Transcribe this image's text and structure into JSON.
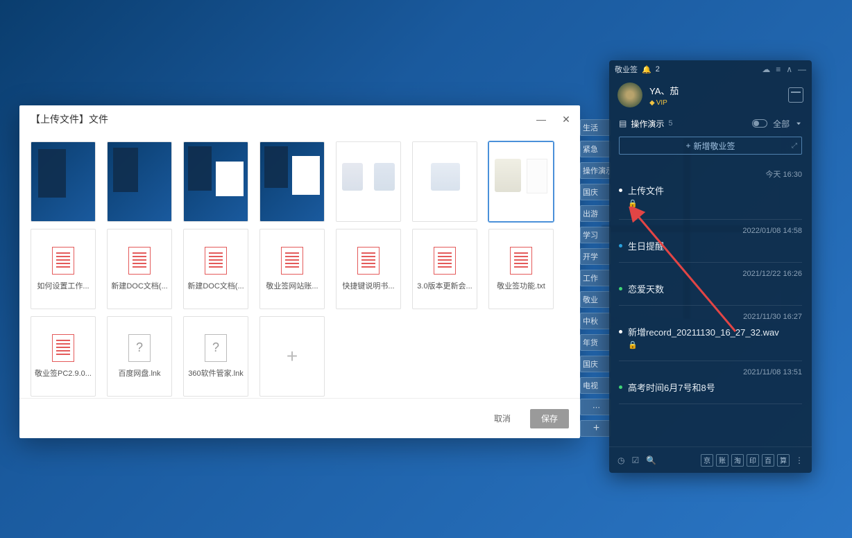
{
  "upload_dialog": {
    "title": "【上传文件】文件",
    "cancel": "取消",
    "save": "保存",
    "thumbs": [
      1,
      2,
      3,
      4,
      5,
      6,
      7
    ],
    "docs": [
      {
        "label": "如何设置工作...",
        "kind": "doc"
      },
      {
        "label": "新建DOC文档(...",
        "kind": "doc"
      },
      {
        "label": "新建DOC文档(...",
        "kind": "doc"
      },
      {
        "label": "敬业签网站账...",
        "kind": "doc"
      },
      {
        "label": "快捷键说明书...",
        "kind": "doc"
      },
      {
        "label": "3.0版本更新会...",
        "kind": "doc"
      },
      {
        "label": "敬业签功能.txt",
        "kind": "doc"
      },
      {
        "label": "敬业签PC2.9.0...",
        "kind": "doc"
      },
      {
        "label": "百度网盘.lnk",
        "kind": "unknown"
      },
      {
        "label": "360软件管家.lnk",
        "kind": "unknown"
      }
    ],
    "add": "+"
  },
  "side_tags": [
    "生活",
    "紧急",
    "操作演示",
    "国庆",
    "出游",
    "学习",
    "开学",
    "工作",
    "敬业",
    "中秋",
    "年货",
    "国庆",
    "电视"
  ],
  "side_more": "⋯",
  "side_plus": "+",
  "sticky": {
    "app_name": "敬业签",
    "notif_count": "2",
    "user_name": "YA、茄",
    "vip_label": "VIP",
    "section_title": "操作演示",
    "section_count": "5",
    "filter_label": "全部",
    "add_label": "新增敬业签",
    "items": [
      {
        "time": "今天 16:30",
        "text": "上传文件",
        "lock": true,
        "dot": "white"
      },
      {
        "time": "2022/01/08 14:58",
        "text": "生日提醒",
        "lock": false,
        "dot": "blue"
      },
      {
        "time": "2021/12/22 16:26",
        "text": "恋爱天数",
        "lock": false,
        "dot": "green"
      },
      {
        "time": "2021/11/30 16:27",
        "text": "新增record_20211130_16_27_32.wav",
        "lock": true,
        "dot": "white"
      },
      {
        "time": "2021/11/08 13:51",
        "text": "高考时间6月7号和8号",
        "lock": false,
        "dot": "green"
      }
    ],
    "footer_sq": [
      "京",
      "账",
      "淘",
      "印",
      "百",
      "算"
    ]
  }
}
